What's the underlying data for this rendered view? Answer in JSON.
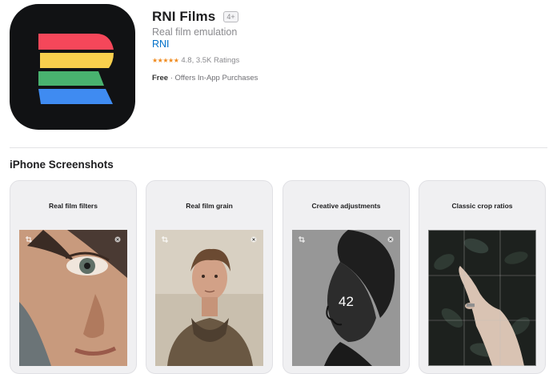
{
  "app": {
    "title": "RNI Films",
    "age_rating": "4+",
    "subtitle": "Real film emulation",
    "developer": "RNI",
    "stars": "★★★★★",
    "rating_text": "4.8, 3.5K Ratings",
    "price": "Free",
    "price_note": "· Offers In-App Purchases"
  },
  "section": {
    "title": "iPhone Screenshots"
  },
  "screenshots": [
    {
      "caption": "Real film filters"
    },
    {
      "caption": "Real film grain"
    },
    {
      "caption": "Creative adjustments",
      "overlay_value": "42"
    },
    {
      "caption": "Classic crop ratios"
    }
  ],
  "colors": {
    "icon_background": "#111214",
    "stripe_red": "#f5475a",
    "stripe_yellow": "#f8cf4d",
    "stripe_green": "#49b26f",
    "stripe_blue": "#3f8bf1",
    "link_blue": "#0070c9",
    "star_orange": "#f08a1d"
  }
}
